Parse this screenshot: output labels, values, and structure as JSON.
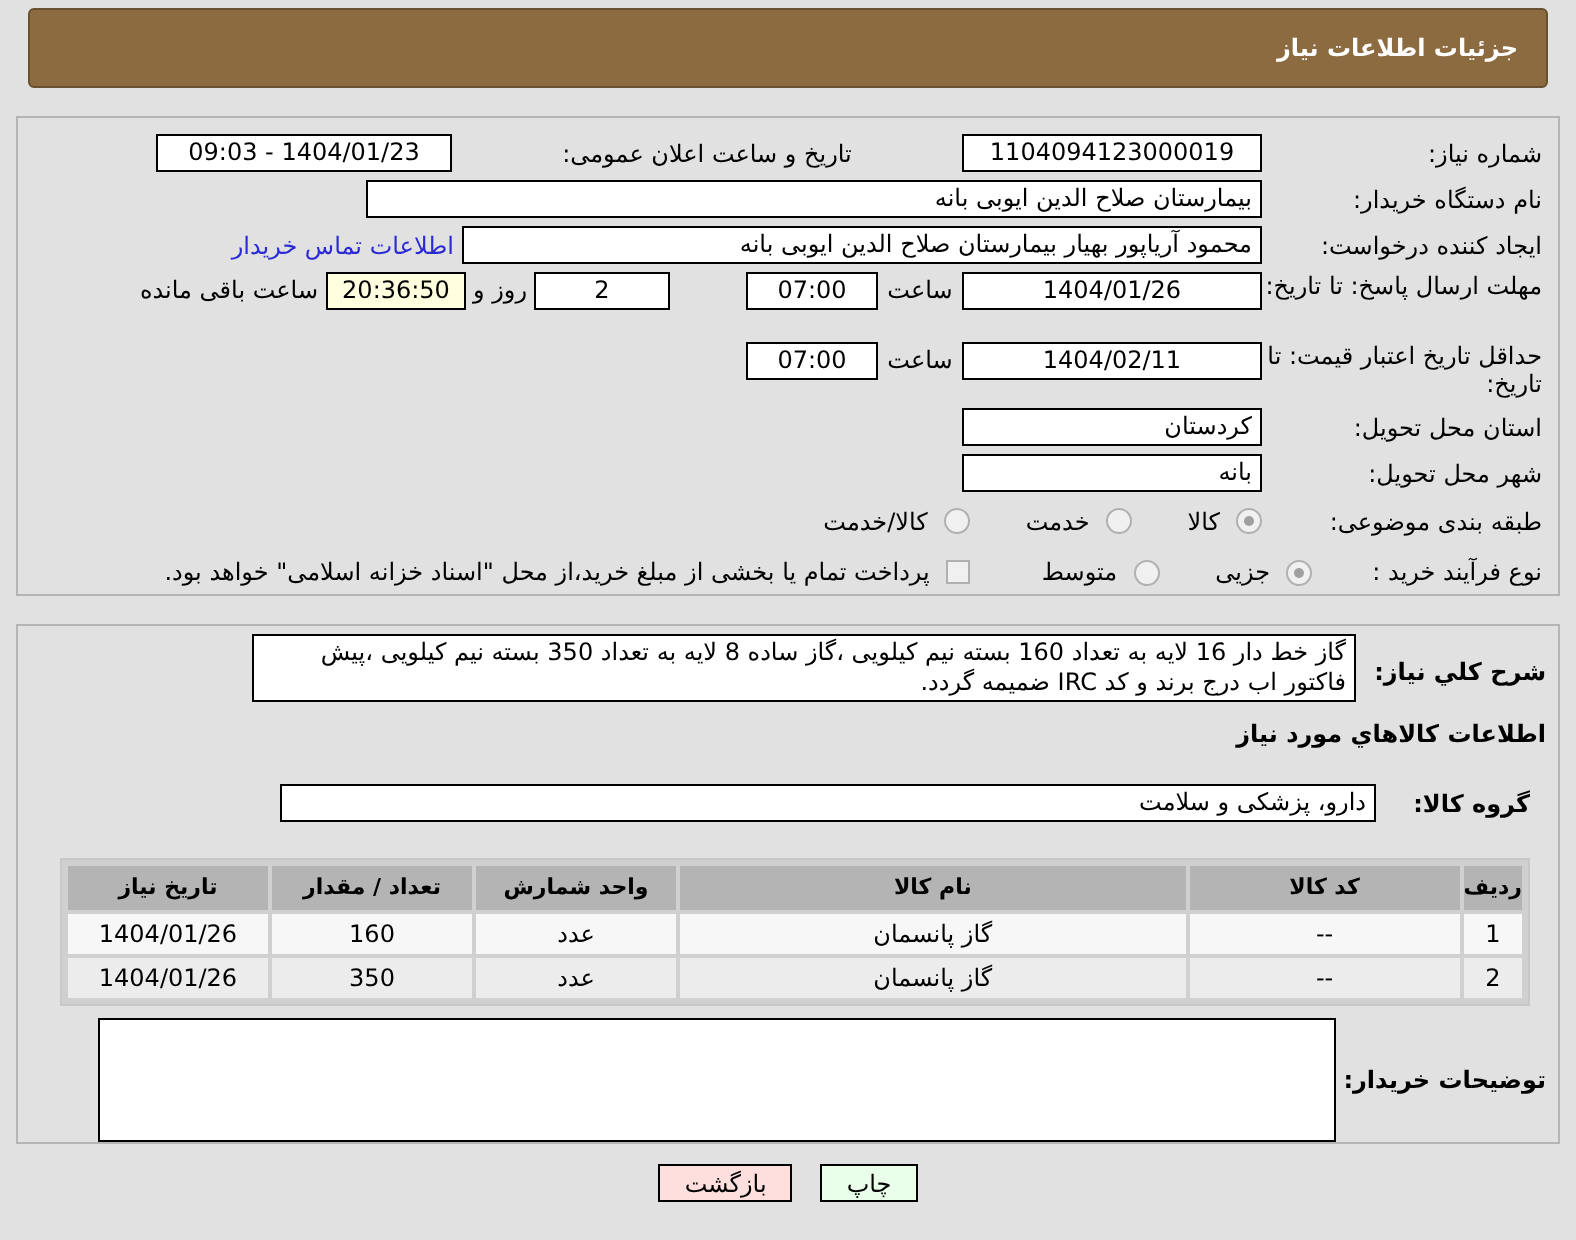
{
  "page_title": "جزئیات اطلاعات نیاز",
  "need_number": {
    "label": "شماره نیاز:",
    "value": "1104094123000019"
  },
  "announce": {
    "label": "تاریخ و ساعت اعلان عمومی:",
    "value": "1404/01/23 - 09:03"
  },
  "buyer_org": {
    "label": "نام دستگاه خریدار:",
    "value": "بیمارستان صلاح الدین ایوبی بانه"
  },
  "requester": {
    "label": "ایجاد کننده درخواست:",
    "value": "محمود آریاپور بهیار بیمارستان صلاح الدین ایوبی بانه",
    "link": "اطلاعات تماس خریدار"
  },
  "deadline": {
    "label": "مهلت ارسال پاسخ: تا تاریخ:",
    "date": "1404/01/26",
    "time_label": "ساعت",
    "time": "07:00",
    "days": "2",
    "days_label": "روز و",
    "remaining": "20:36:50",
    "remaining_label": "ساعت باقی مانده"
  },
  "validity": {
    "label": "حداقل تاریخ اعتبار قیمت: تا تاریخ:",
    "date": "1404/02/11",
    "time_label": "ساعت",
    "time": "07:00"
  },
  "province": {
    "label": "استان محل تحویل:",
    "value": "کردستان"
  },
  "city": {
    "label": "شهر محل تحویل:",
    "value": "بانه"
  },
  "category": {
    "label": "طبقه بندی موضوعی:",
    "options": [
      {
        "label": "کالا",
        "selected": true
      },
      {
        "label": "خدمت",
        "selected": false
      },
      {
        "label": "کالا/خدمت",
        "selected": false
      }
    ]
  },
  "process": {
    "label": "نوع فرآیند خرید :",
    "options": [
      {
        "label": "جزیی",
        "selected": true
      },
      {
        "label": "متوسط",
        "selected": false
      }
    ],
    "payment": {
      "checked": false,
      "label": "پرداخت تمام یا بخشی از مبلغ خرید،از محل \"اسناد خزانه اسلامی\" خواهد بود."
    }
  },
  "description": {
    "label": "شرح کلي نياز:",
    "value": "گاز خط دار 16 لایه به تعداد 160 بسته نیم کیلویی ،گاز ساده 8 لایه به تعداد 350 بسته نیم کیلویی ،پیش فاکتور اب درج برند و کد IRC ضمیمه گردد."
  },
  "goods_title": "اطلاعات کالاهاي مورد نياز",
  "goods_group": {
    "label": "گروه کالا:",
    "value": "دارو، پزشکی و سلامت"
  },
  "table": {
    "columns": [
      "ردیف",
      "کد کالا",
      "نام کالا",
      "واحد شمارش",
      "تعداد / مقدار",
      "تاریخ نیاز"
    ],
    "rows": [
      [
        "1",
        "--",
        "گاز پانسمان",
        "عدد",
        "160",
        "1404/01/26"
      ],
      [
        "2",
        "--",
        "گاز پانسمان",
        "عدد",
        "350",
        "1404/01/26"
      ]
    ]
  },
  "buyer_notes": {
    "label": "توضیحات خریدار:"
  },
  "buttons": [
    {
      "label": "چاپ",
      "kind": "print"
    },
    {
      "label": "بازگشت",
      "kind": "back"
    }
  ]
}
